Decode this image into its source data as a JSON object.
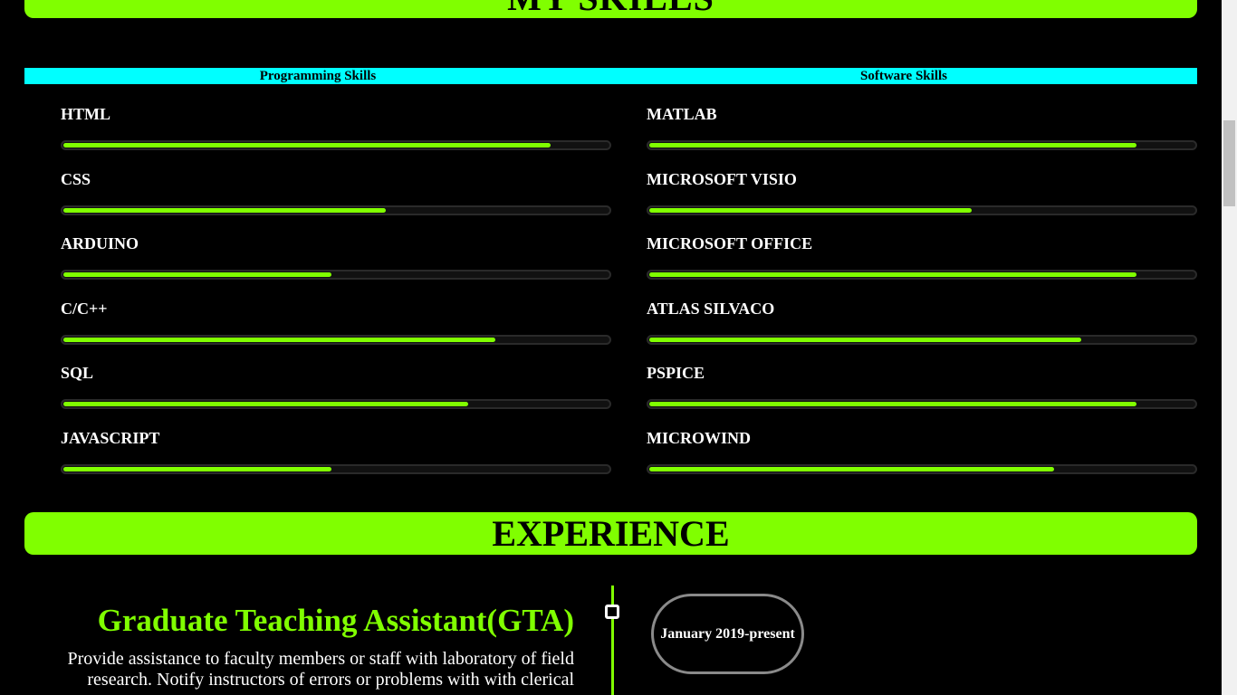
{
  "skills_section": {
    "title": "MY SKILLS",
    "programming_title": "Programming Skills",
    "software_title": "Software Skills",
    "programming": [
      {
        "name": "HTML",
        "level": 0.89
      },
      {
        "name": "CSS",
        "level": 0.59
      },
      {
        "name": "ARDUINO",
        "level": 0.49
      },
      {
        "name": "C/C++",
        "level": 0.79
      },
      {
        "name": "SQL",
        "level": 0.74
      },
      {
        "name": "JAVASCRIPT",
        "level": 0.49
      }
    ],
    "software": [
      {
        "name": "MATLAB",
        "level": 0.89
      },
      {
        "name": "MICROSOFT VISIO",
        "level": 0.59
      },
      {
        "name": "MICROSOFT OFFICE",
        "level": 0.89
      },
      {
        "name": "ATLAS SILVACO",
        "level": 0.79
      },
      {
        "name": "PSPICE",
        "level": 0.89
      },
      {
        "name": "MICROWIND",
        "level": 0.74
      }
    ]
  },
  "experience_section": {
    "title": "EXPERIENCE",
    "job_title": "Graduate Teaching Assistant(GTA)",
    "description": "Provide assistance to faculty members or staff with laboratory of field research. Notify instructors of errors or problems with with clerical",
    "date": "January 2019-present"
  },
  "colors": {
    "accent": "#80ff00",
    "category_bar": "#00ffff",
    "background": "#000000"
  }
}
